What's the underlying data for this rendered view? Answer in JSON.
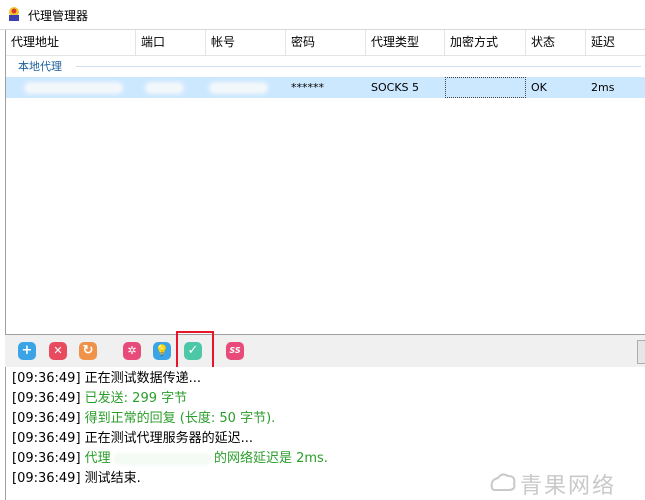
{
  "window": {
    "title": "代理管理器"
  },
  "grid": {
    "columns": [
      "代理地址",
      "端口",
      "帐号",
      "密码",
      "代理类型",
      "加密方式",
      "状态",
      "延迟"
    ],
    "group": "本地代理",
    "row": {
      "address": "",
      "port": "",
      "account": "",
      "password": "******",
      "type": "SOCKS 5",
      "encryption": "",
      "status": "OK",
      "latency": "2ms"
    }
  },
  "toolbar": {
    "buttons": [
      {
        "icon": "add-icon",
        "glyph": "+",
        "color": "#3aa4e6"
      },
      {
        "icon": "delete-icon",
        "glyph": "✕",
        "color": "#e84a5f"
      },
      {
        "icon": "refresh-icon",
        "glyph": "↻",
        "color": "#f0934a"
      },
      {
        "icon": "settings-icon",
        "glyph": "✲",
        "color": "#e84a7a"
      },
      {
        "icon": "lightbulb-icon",
        "glyph": "💡",
        "color": "#3aa4e6"
      },
      {
        "icon": "check-icon",
        "glyph": "✓",
        "color": "#4cc7a8"
      },
      {
        "icon": "ss-icon",
        "glyph": "SS",
        "color": "#e84a7a"
      }
    ]
  },
  "log": [
    {
      "time": "[09:36:49]",
      "text": "正在测试数据传递...",
      "color": "black"
    },
    {
      "time": "[09:36:49]",
      "text": "已发送: 299 字节",
      "color": "green"
    },
    {
      "time": "[09:36:49]",
      "text": "得到正常的回复 (长度: 50 字节).",
      "color": "green"
    },
    {
      "time": "[09:36:49]",
      "text": "正在测试代理服务器的延迟...",
      "color": "black"
    },
    {
      "time": "[09:36:49]",
      "text_prefix": "代理",
      "text_suffix": "的网络延迟是 2ms.",
      "color": "green"
    },
    {
      "time": "[09:36:49]",
      "text": "测试结束.",
      "color": "black"
    }
  ],
  "watermark": "青果网络"
}
